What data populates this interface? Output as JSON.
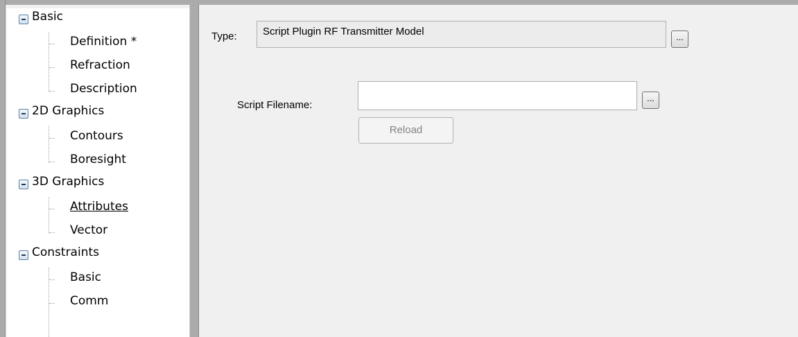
{
  "tree": {
    "groups": [
      {
        "label": "Basic",
        "children": [
          "Definition *",
          "Refraction",
          "Description"
        ]
      },
      {
        "label": "2D Graphics",
        "children": [
          "Contours",
          "Boresight"
        ]
      },
      {
        "label": "3D Graphics",
        "children": [
          "Attributes",
          "Vector"
        ]
      },
      {
        "label": "Constraints",
        "children": [
          "Basic",
          "Comm"
        ]
      }
    ]
  },
  "form": {
    "type_label": "Type:",
    "type_value": "Script Plugin RF Transmitter Model",
    "type_browse": "...",
    "script_label": "Script Filename:",
    "script_value": "",
    "script_browse": "...",
    "reload_label": "Reload"
  },
  "colors": {
    "panel_bg": "#f0f0f0",
    "tree_bg": "#ffffff",
    "border_gray": "#ababab",
    "disabled_text": "#838383"
  }
}
